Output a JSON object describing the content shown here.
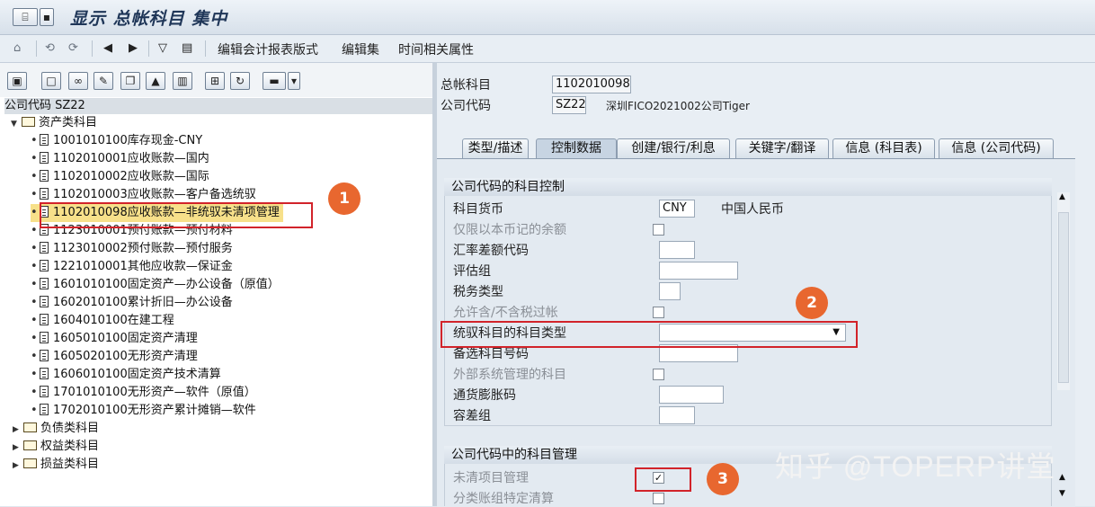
{
  "title": "显示 总帐科目 集中",
  "toolbar": {
    "edit_report_format": "编辑会计报表版式",
    "edit_set": "编辑集",
    "time_attributes": "时间相关属性"
  },
  "tree": {
    "company_code_header": "公司代码 SZ22",
    "root_folder": "资产类科目",
    "items": [
      "1001010100库存现金-CNY",
      "1102010001应收账款—国内",
      "1102010002应收账款—国际",
      "1102010003应收账款—客户备选统驭",
      "1102010098应收账款—非统驭未清项管理",
      "1123010001预付账款—预付材料",
      "1123010002预付账款—预付服务",
      "1221010001其他应收款—保证金",
      "1601010100固定资产—办公设备（原值）",
      "1602010100累计折旧—办公设备",
      "1604010100在建工程",
      "1605010100固定资产清理",
      "1605020100无形资产清理",
      "1606010100固定资产技术清算",
      "1701010100无形资产—软件（原值）",
      "1702010100无形资产累计摊销—软件"
    ],
    "other_folders": [
      "负债类科目",
      "权益类科目",
      "损益类科目"
    ]
  },
  "header": {
    "gl_account_label": "总帐科目",
    "gl_account_value": "1102010098",
    "company_code_label": "公司代码",
    "company_code_value": "SZ22",
    "company_name": "深圳FICO2021002公司Tiger"
  },
  "tabs": [
    "类型/描述",
    "控制数据",
    "创建/银行/利息",
    "关键字/翻译",
    "信息 (科目表)",
    "信息 (公司代码)"
  ],
  "account_control": {
    "group_title": "公司代码的科目控制",
    "currency_label": "科目货币",
    "currency_value": "CNY",
    "currency_name": "中国人民币",
    "local_balance_only": "仅限以本币记的余额",
    "exchange_rate_diff": "汇率差额代码",
    "valuation_group": "评估组",
    "tax_category": "税务类型",
    "posting_without_tax": "允许含/不含税过帐",
    "recon_account_type": "统驭科目的科目类型",
    "alt_account_no": "备选科目号码",
    "externally_managed": "外部系统管理的科目",
    "inflation_key": "通货膨胀码",
    "tolerance_group": "容差组"
  },
  "account_management": {
    "group_title": "公司代码中的科目管理",
    "open_item_mgmt": "未清项目管理",
    "open_item_mgmt_checked": true,
    "ledger_group_clearing": "分类账组特定清算"
  },
  "annotations": [
    "1",
    "2",
    "3"
  ],
  "watermark": "知乎 @TOPERP讲堂"
}
